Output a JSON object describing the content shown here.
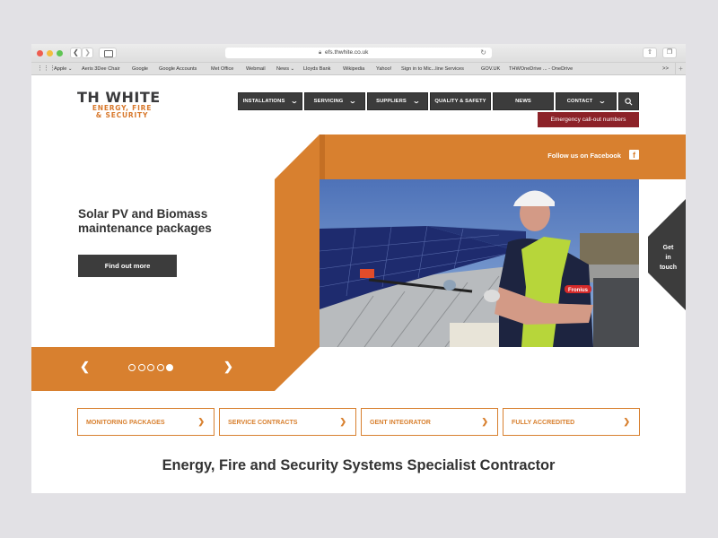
{
  "browser": {
    "url": "efs.thwhite.co.uk",
    "bookmarks": [
      {
        "label": "Apple ⌄"
      },
      {
        "label": "Aeris 3Dee Chair"
      },
      {
        "label": "Google"
      },
      {
        "label": "Google Accounts"
      },
      {
        "label": "Met Office"
      },
      {
        "label": "Webmail"
      },
      {
        "label": "News ⌄"
      },
      {
        "label": "Lloyds Bank"
      },
      {
        "label": "Wikipedia"
      },
      {
        "label": "Yahoo!"
      },
      {
        "label": "Sign in to Mic...line Services"
      },
      {
        "label": "GOV.UK"
      },
      {
        "label": "THWOneDrive ... - OneDrive"
      }
    ],
    "more_label": ">>",
    "add_label": "+"
  },
  "logo": {
    "main": "TH WHITE",
    "sub_line1": "ENERGY, FIRE",
    "sub_line2": "& SECURITY"
  },
  "nav": {
    "items": [
      {
        "label": "INSTALLATIONS",
        "dropdown": true
      },
      {
        "label": "SERVICING",
        "dropdown": true
      },
      {
        "label": "SUPPLIERS",
        "dropdown": true
      },
      {
        "label": "QUALITY & SAFETY",
        "dropdown": false
      },
      {
        "label": "NEWS",
        "dropdown": false
      },
      {
        "label": "CONTACT",
        "dropdown": true
      }
    ],
    "search_icon": "search-icon",
    "emergency_label": "Emergency call-out numbers"
  },
  "hero": {
    "facebook_label": "Follow us on Facebook",
    "title_line1": "Solar PV and Biomass",
    "title_line2": "maintenance packages",
    "cta_label": "Find out more",
    "prev_label": "❮",
    "next_label": "❯",
    "slide_count": 5,
    "active_slide": 5,
    "photo_alt": "Engineer in hard hat cleaning solar panels on a roof",
    "badge_text": "Fronius"
  },
  "get_in_touch": {
    "line1": "Get",
    "line2": "in",
    "line3": "touch"
  },
  "features": [
    {
      "label": "MONITORING PACKAGES",
      "chevron": "❯"
    },
    {
      "label": "SERVICE CONTRACTS",
      "chevron": "❯"
    },
    {
      "label": "GENT INTEGRATOR",
      "chevron": "❯"
    },
    {
      "label": "FULLY ACCREDITED",
      "chevron": "❯"
    }
  ],
  "tagline": "Energy, Fire and Security Systems Specialist Contractor",
  "colors": {
    "brand_orange": "#d8802f",
    "nav_dark": "#3c3c3c",
    "emergency_red": "#8c2228",
    "text_dark": "#333333"
  }
}
